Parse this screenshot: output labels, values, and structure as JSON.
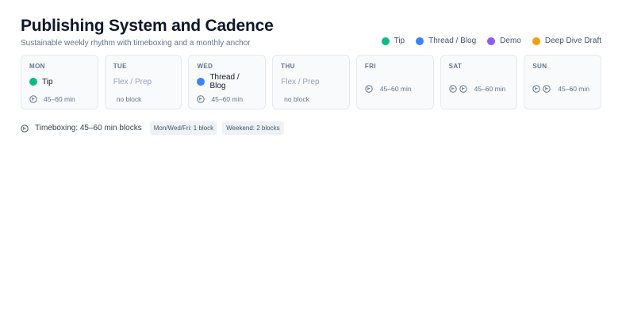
{
  "header": {
    "title": "Publishing System and Cadence",
    "subtitle": "Sustainable weekly rhythm with timeboxing and a monthly anchor"
  },
  "legend": [
    {
      "label": "Tip",
      "color": "#10b981"
    },
    {
      "label": "Thread / Blog",
      "color": "#3b82f6"
    },
    {
      "label": "Demo",
      "color": "#8b5cf6"
    },
    {
      "label": "Deep Dive Draft",
      "color": "#f59e0b"
    }
  ],
  "days": [
    {
      "name": "MON",
      "activity": "Tip",
      "activity_color": "#10b981",
      "time": "45–60 min"
    },
    {
      "name": "TUE",
      "activity": "Flex / Prep",
      "time": "no block"
    },
    {
      "name": "WED",
      "activity": "Thread / Blog",
      "activity_color": "#3b82f6",
      "time": "45–60 min"
    },
    {
      "name": "THU",
      "activity": "Flex / Prep",
      "time": "no block"
    },
    {
      "name": "FRI",
      "time": "45–60 min"
    },
    {
      "name": "SAT",
      "time": "45–60 min"
    },
    {
      "name": "SUN",
      "time": "45–60 min"
    }
  ],
  "footer": {
    "timeboxing": "Timeboxing: 45–60 min blocks",
    "chip_weekday": "Mon/Wed/Fri: 1 block",
    "chip_weekend": "Weekend: 2 blocks"
  }
}
